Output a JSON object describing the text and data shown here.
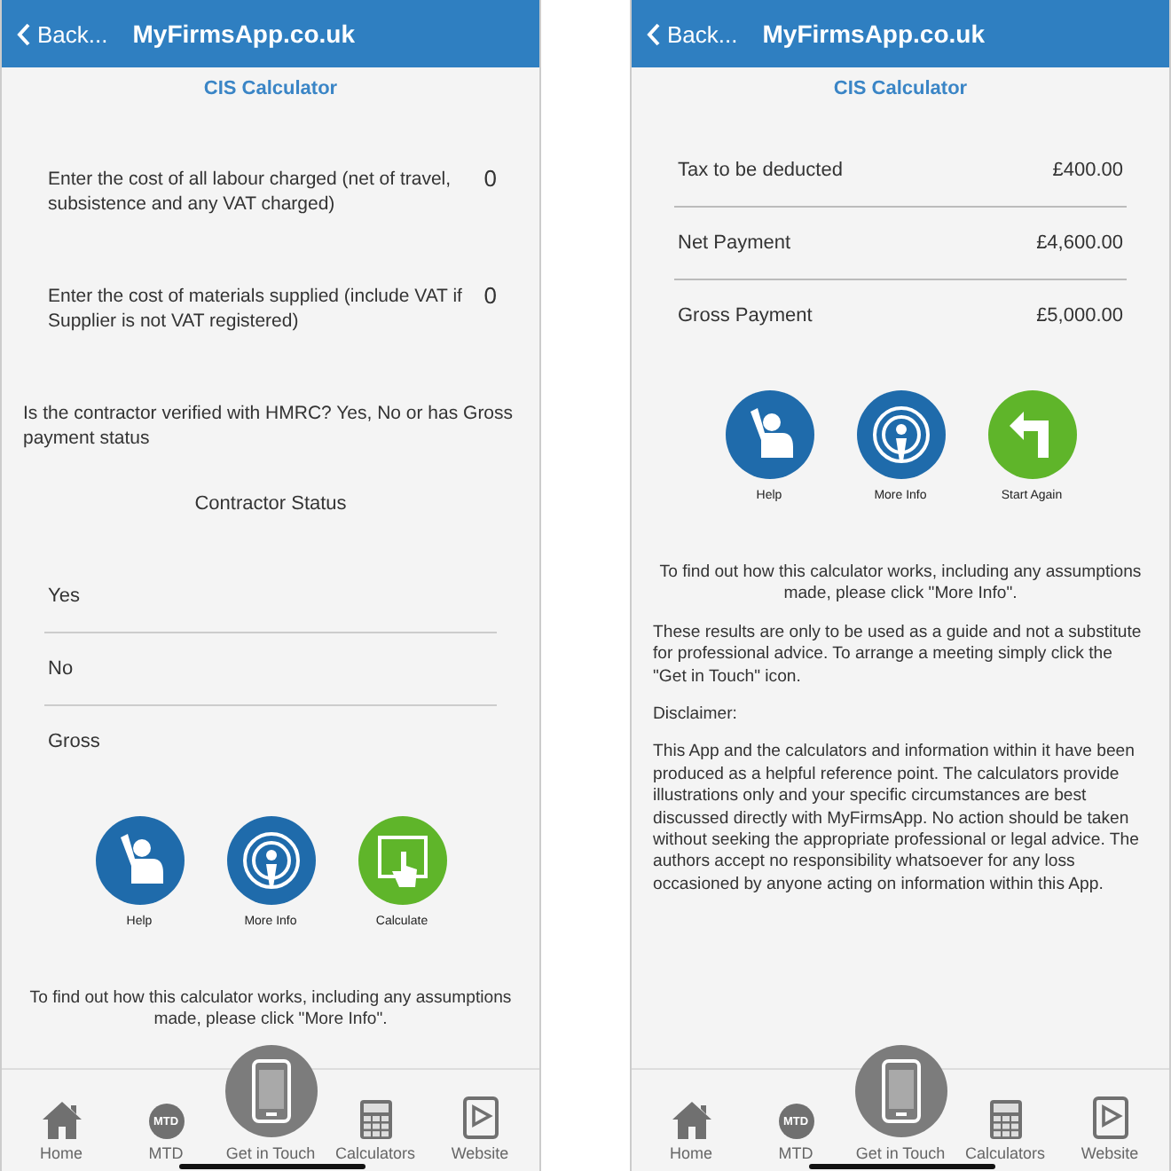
{
  "screens": [
    {
      "back": "Back...",
      "title": "MyFirmsApp.co.uk",
      "subtitle": "CIS Calculator",
      "fields": [
        {
          "label": "Enter the cost of all labour charged (net of travel, subsistence and any VAT charged)",
          "value": "0"
        },
        {
          "label": "Enter the cost of materials supplied (include VAT if Supplier is not VAT registered)",
          "value": "0"
        }
      ],
      "question": "Is the contractor verified with HMRC? Yes, No or has Gross payment status",
      "status_title": "Contractor Status",
      "options": [
        "Yes",
        "No",
        "Gross"
      ],
      "actions": [
        {
          "kind": "help",
          "label": "Help",
          "color": "#1f6bab"
        },
        {
          "kind": "info",
          "label": "More Info",
          "color": "#1f6bab"
        },
        {
          "kind": "calculate",
          "label": "Calculate",
          "color": "#5fb52a"
        }
      ],
      "paragraphs": [
        "To find out how this calculator works, including any assumptions made, please click \"More Info\"."
      ],
      "nav": [
        {
          "kind": "home",
          "label": "Home"
        },
        {
          "kind": "mtd",
          "label": "MTD",
          "badge": "MTD"
        },
        {
          "kind": "phone",
          "label": "Get in Touch"
        },
        {
          "kind": "calculator",
          "label": "Calculators"
        },
        {
          "kind": "website",
          "label": "Website"
        }
      ]
    },
    {
      "back": "Back...",
      "title": "MyFirmsApp.co.uk",
      "subtitle": "CIS Calculator",
      "results": [
        {
          "label": "Tax to be deducted",
          "value": "£400.00"
        },
        {
          "label": "Net Payment",
          "value": "£4,600.00"
        },
        {
          "label": "Gross Payment",
          "value": "£5,000.00"
        }
      ],
      "actions": [
        {
          "kind": "help",
          "label": "Help",
          "color": "#1f6bab"
        },
        {
          "kind": "info",
          "label": "More Info",
          "color": "#1f6bab"
        },
        {
          "kind": "restart",
          "label": "Start Again",
          "color": "#5fb52a"
        }
      ],
      "paragraphs": [
        "To find out how this calculator works, including any assumptions made, please click \"More Info\".",
        "These results are only to be used as a guide and not a substitute for professional advice. To arrange a meeting simply click the \"Get in Touch\" icon.",
        "Disclaimer:",
        "This App and the calculators and information within it have been produced as a helpful reference point. The calculators provide illustrations only and your specific circumstances are best discussed directly with MyFirmsApp. No action should be taken without seeking the appropriate professional or legal advice. The authors accept no responsibility whatsoever for any loss occasioned by anyone acting on information within this App."
      ],
      "nav": [
        {
          "kind": "home",
          "label": "Home"
        },
        {
          "kind": "mtd",
          "label": "MTD",
          "badge": "MTD"
        },
        {
          "kind": "phone",
          "label": "Get in Touch"
        },
        {
          "kind": "calculator",
          "label": "Calculators"
        },
        {
          "kind": "website",
          "label": "Website"
        }
      ]
    }
  ]
}
